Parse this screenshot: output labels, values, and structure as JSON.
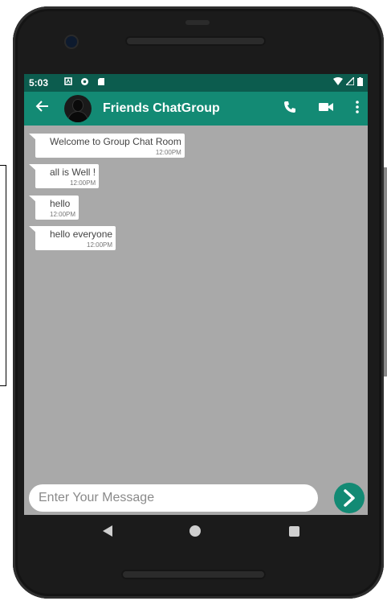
{
  "status_bar": {
    "time": "5:03",
    "left_icons": [
      "notification-icon",
      "location-icon",
      "sd-card-icon"
    ],
    "right_icons": [
      "wifi-icon",
      "signal-icon",
      "battery-icon"
    ]
  },
  "app_bar": {
    "title": "Friends ChatGroup",
    "actions": [
      "phone-icon",
      "video-icon",
      "more-vert-icon"
    ],
    "color": "#138a74",
    "status_color": "#0c5c4e"
  },
  "messages": [
    {
      "text": "Welcome to Group Chat Room",
      "time": "12:00PM"
    },
    {
      "text": "all is Well !",
      "time": "12:00PM"
    },
    {
      "text": "hello",
      "time": "12:00PM"
    },
    {
      "text": "hello everyone",
      "time": "12:00PM"
    }
  ],
  "composer": {
    "placeholder": "Enter Your Message",
    "send_icon": "chevron-right-icon"
  },
  "nav": {
    "buttons": [
      "back-triangle-icon",
      "home-circle-icon",
      "recents-square-icon"
    ]
  }
}
